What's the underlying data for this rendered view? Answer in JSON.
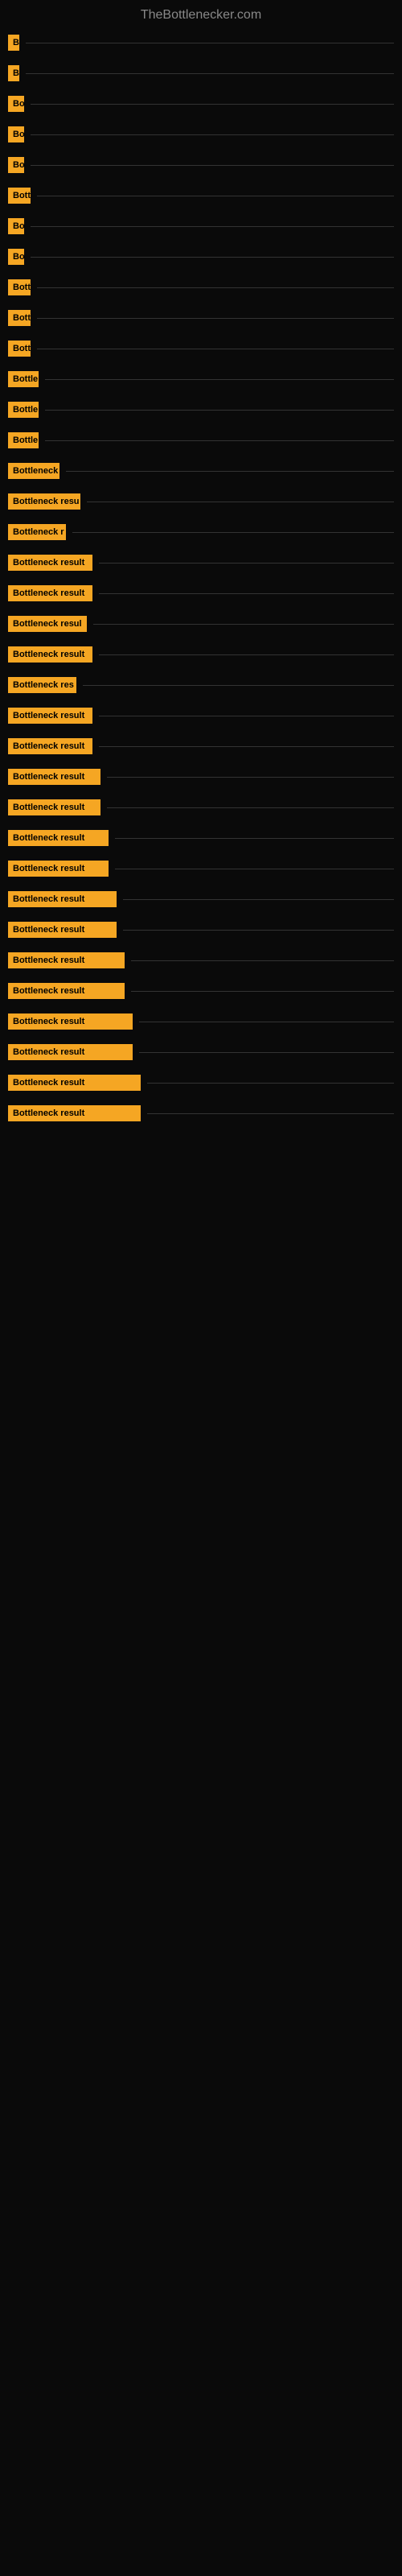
{
  "site": {
    "title": "TheBottlenecker.com"
  },
  "items": [
    {
      "label": "B",
      "width": 14
    },
    {
      "label": "B",
      "width": 14
    },
    {
      "label": "Bo",
      "width": 20
    },
    {
      "label": "Bo",
      "width": 20
    },
    {
      "label": "Bo",
      "width": 20
    },
    {
      "label": "Bott",
      "width": 28
    },
    {
      "label": "Bo",
      "width": 20
    },
    {
      "label": "Bo",
      "width": 20
    },
    {
      "label": "Bott",
      "width": 28
    },
    {
      "label": "Bott",
      "width": 28
    },
    {
      "label": "Bott",
      "width": 28
    },
    {
      "label": "Bottle",
      "width": 38
    },
    {
      "label": "Bottle",
      "width": 38
    },
    {
      "label": "Bottle",
      "width": 38
    },
    {
      "label": "Bottleneck",
      "width": 64
    },
    {
      "label": "Bottleneck resu",
      "width": 90
    },
    {
      "label": "Bottleneck r",
      "width": 72
    },
    {
      "label": "Bottleneck result",
      "width": 105
    },
    {
      "label": "Bottleneck result",
      "width": 105
    },
    {
      "label": "Bottleneck resul",
      "width": 98
    },
    {
      "label": "Bottleneck result",
      "width": 105
    },
    {
      "label": "Bottleneck res",
      "width": 85
    },
    {
      "label": "Bottleneck result",
      "width": 105
    },
    {
      "label": "Bottleneck result",
      "width": 105
    },
    {
      "label": "Bottleneck result",
      "width": 115
    },
    {
      "label": "Bottleneck result",
      "width": 115
    },
    {
      "label": "Bottleneck result",
      "width": 125
    },
    {
      "label": "Bottleneck result",
      "width": 125
    },
    {
      "label": "Bottleneck result",
      "width": 135
    },
    {
      "label": "Bottleneck result",
      "width": 135
    },
    {
      "label": "Bottleneck result",
      "width": 145
    },
    {
      "label": "Bottleneck result",
      "width": 145
    },
    {
      "label": "Bottleneck result",
      "width": 155
    },
    {
      "label": "Bottleneck result",
      "width": 155
    },
    {
      "label": "Bottleneck result",
      "width": 165
    },
    {
      "label": "Bottleneck result",
      "width": 165
    }
  ]
}
